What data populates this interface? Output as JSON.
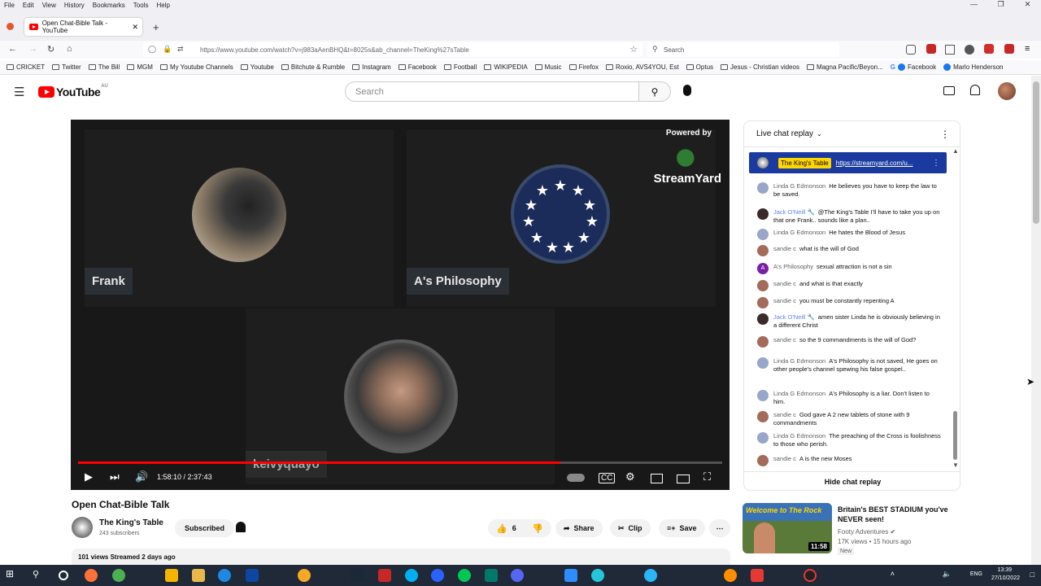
{
  "browser": {
    "menu": [
      "File",
      "Edit",
      "View",
      "History",
      "Bookmarks",
      "Tools",
      "Help"
    ],
    "tab_title": "Open Chat-Bible Talk - YouTube",
    "url": "https://www.youtube.com/watch?v=j983aAenBHQ&t=8025s&ab_channel=TheKing%27sTable",
    "search_placeholder": "Search",
    "bookmarks": [
      "CRICKET",
      "Twitter",
      "The Bill",
      "MGM",
      "My Youtube Channels",
      "Youtube",
      "Bitchute & Rumble",
      "Instagram",
      "Facebook",
      "Football",
      "WIKIPEDIA",
      "Music",
      "Firefox",
      "Roxio, AVS4YOU, Est",
      "Optus",
      "Jesus - Christian videos",
      "Magna Pacific/Beyon...",
      "Facebook",
      "Marlo Henderson"
    ]
  },
  "youtube": {
    "logo_text": "YouTube",
    "region": "AU",
    "search_placeholder": "Search"
  },
  "player": {
    "powered_by": "Powered by",
    "brand": "StreamYard",
    "participants": [
      "Frank",
      "A's Philosophy",
      "keivyquayo"
    ],
    "time_current": "1:58:10",
    "time_total": "2:37:43",
    "progress": 0.749
  },
  "video": {
    "title": "Open Chat-Bible Talk",
    "channel": "The King's Table",
    "subscribers": "243 subscribers",
    "subscribe_label": "Subscribed",
    "likes": "6",
    "share_label": "Share",
    "clip_label": "Clip",
    "save_label": "Save",
    "views_line": "101 views  Streamed 2 days ago"
  },
  "chat": {
    "header": "Live chat replay",
    "pinned_author": "The King's Table",
    "pinned_link": "https://streamyard.com/u...",
    "messages": [
      {
        "author": "Linda G Edmonson",
        "text": "He believes you have to keep the law to be saved.",
        "color": "#9aa6c9",
        "mod": false
      },
      {
        "author": "Jack O'Neill 🔧",
        "text": "@The King's Table I'll have to take you up on that one Frank.. sounds like a plan..",
        "color": "#3a2a2a",
        "mod": true
      },
      {
        "author": "Linda G Edmonson",
        "text": "He hates the Blood of Jesus",
        "color": "#9aa6c9",
        "mod": false
      },
      {
        "author": "sandie c",
        "text": "what is the will of God",
        "color": "#a46a5a",
        "mod": false
      },
      {
        "author": "A's Philosophy",
        "text": "sexual attraction is not a sin",
        "color": "#7b1fa2",
        "mod": false
      },
      {
        "author": "sandie c",
        "text": "and what is that exactly",
        "color": "#a46a5a",
        "mod": false
      },
      {
        "author": "sandie c",
        "text": "you must be constantly repenting A",
        "color": "#a46a5a",
        "mod": false
      },
      {
        "author": "Jack O'Neill 🔧",
        "text": "amen sister Linda he is obviously believing in a different Christ",
        "color": "#3a2a2a",
        "mod": true
      },
      {
        "author": "sandie c",
        "text": "so the 9 commandments is the will of God?",
        "color": "#a46a5a",
        "mod": false
      },
      {
        "author": "Linda G Edmonson",
        "text": "A's Philosophy is not saved, He goes on other people's channel spewing his false gospel..",
        "color": "#9aa6c9",
        "mod": false
      },
      {
        "author": "Linda G Edmonson",
        "text": "A's Philosophy is a liar. Don't listen to him.",
        "color": "#9aa6c9",
        "mod": false
      },
      {
        "author": "sandie c",
        "text": "God gave A 2 new tablets of stone with 9 commandments",
        "color": "#a46a5a",
        "mod": false
      },
      {
        "author": "Linda G Edmonson",
        "text": "The preaching of the Cross is foolishness to those who perish.",
        "color": "#9aa6c9",
        "mod": false
      },
      {
        "author": "sandie c",
        "text": "A is the new Moses",
        "color": "#a46a5a",
        "mod": false
      }
    ],
    "hide_label": "Hide chat replay"
  },
  "recommendation": {
    "title": "Britain's BEST STADIUM you've NEVER seen!",
    "channel": "Footy Adventures",
    "meta": "17K views • 15 hours ago",
    "badge": "New",
    "duration": "11:58",
    "thumb_text": "Welcome to The Rock"
  },
  "taskbar": {
    "language": "ENG",
    "time": "13:39",
    "date": "27/10/2022"
  }
}
